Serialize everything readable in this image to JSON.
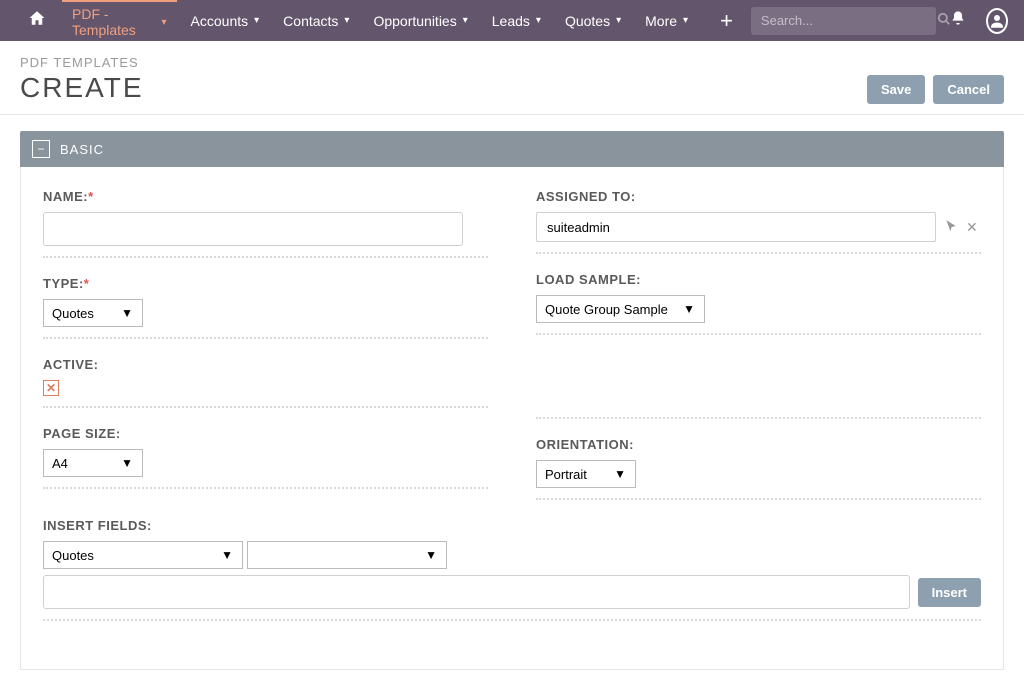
{
  "nav": {
    "items": [
      {
        "label": "PDF - Templates",
        "active": true
      },
      {
        "label": "Accounts"
      },
      {
        "label": "Contacts"
      },
      {
        "label": "Opportunities"
      },
      {
        "label": "Leads"
      },
      {
        "label": "Quotes"
      },
      {
        "label": "More"
      }
    ],
    "search_placeholder": "Search..."
  },
  "header": {
    "breadcrumb": "PDF TEMPLATES",
    "title": "CREATE",
    "save": "Save",
    "cancel": "Cancel"
  },
  "panel": {
    "title": "BASIC"
  },
  "form": {
    "name_label": "NAME:",
    "name_value": "",
    "type_label": "TYPE:",
    "type_value": "Quotes",
    "active_label": "ACTIVE:",
    "pagesize_label": "PAGE SIZE:",
    "pagesize_value": "A4",
    "insertfields_label": "INSERT FIELDS:",
    "insertfields_value": "Quotes",
    "assigned_label": "ASSIGNED TO:",
    "assigned_value": "suiteadmin",
    "loadsample_label": "LOAD SAMPLE:",
    "loadsample_value": "Quote Group Sample",
    "orientation_label": "ORIENTATION:",
    "orientation_value": "Portrait",
    "insert_btn": "Insert"
  }
}
